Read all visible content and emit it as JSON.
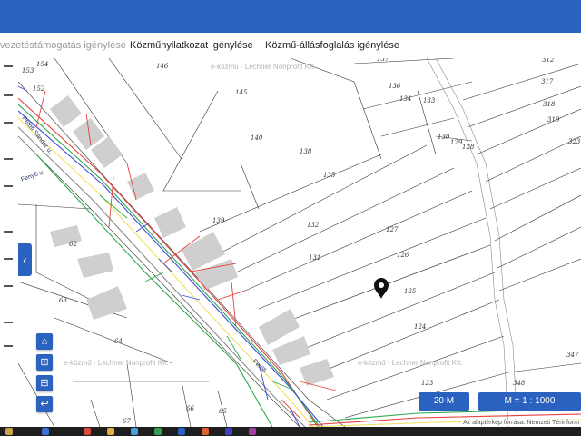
{
  "header": {
    "accent_color": "#2b62c0"
  },
  "tabs": [
    {
      "label": "vezetéstámogatás igénylése",
      "active": false
    },
    {
      "label": "Közműnyilatkozat igénylése",
      "active": false
    },
    {
      "label": "Közmű-állásfoglalás igénylése",
      "active": false
    }
  ],
  "map": {
    "parcels": [
      "154",
      "153",
      "152",
      "146",
      "145",
      "140",
      "139",
      "138",
      "135",
      "132",
      "131",
      "62",
      "63",
      "64",
      "66",
      "65",
      "67",
      "137",
      "136",
      "134",
      "133",
      "130",
      "129",
      "128",
      "127",
      "126",
      "125",
      "124",
      "123",
      "312",
      "317",
      "318",
      "319",
      "323",
      "347",
      "348"
    ],
    "watermarks": [
      "e-közmű - Lechner Nonprofit Kft.",
      "e-közmű - Lechner Nonprofit Kft.",
      "e-közmű - Lechner Nonprofit Kft."
    ],
    "streets": [
      "Petőfi Sándor u.",
      "Fenyő u.",
      "Petőfi"
    ],
    "marker_icon": "map-pin-icon"
  },
  "controls": {
    "collapse_icon": "chevron-left-icon",
    "home_icon": "home-icon",
    "zoom_in_icon": "zoom-in-icon",
    "zoom_out_icon": "zoom-out-icon",
    "back_icon": "back-arrow-icon"
  },
  "scale": {
    "distance": "20 M",
    "ratio": "M = 1 : 1000"
  },
  "attribution": "Az alaptérkép forrása: Nemzeti Térinform"
}
